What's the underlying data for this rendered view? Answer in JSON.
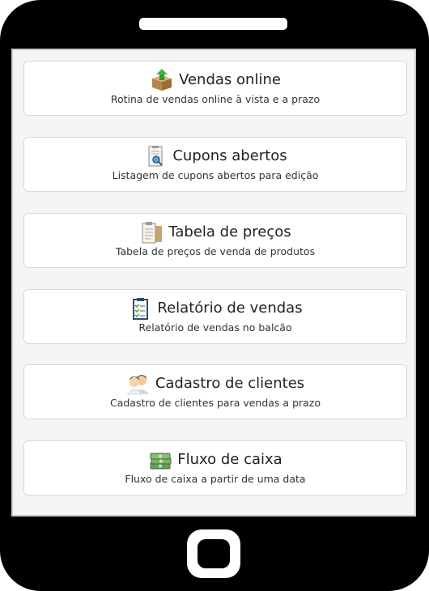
{
  "menu": [
    {
      "title": "Vendas online",
      "subtitle": "Rotina de vendas online à vista e a prazo",
      "icon": "package-upload-icon"
    },
    {
      "title": "Cupons abertos",
      "subtitle": "Listagem de cupons abertos para edição",
      "icon": "receipt-search-icon"
    },
    {
      "title": "Tabela de preços",
      "subtitle": "Tabela de preços de venda de produtos",
      "icon": "price-clipboard-icon"
    },
    {
      "title": "Relatório de vendas",
      "subtitle": "Relatório de vendas no balcão",
      "icon": "checklist-clipboard-icon"
    },
    {
      "title": "Cadastro de clientes",
      "subtitle": "Cadastro de clientes para vendas a prazo",
      "icon": "customers-icon"
    },
    {
      "title": "Fluxo de caixa",
      "subtitle": "Fluxo de caixa a partir de uma data",
      "icon": "cash-stack-icon"
    }
  ]
}
